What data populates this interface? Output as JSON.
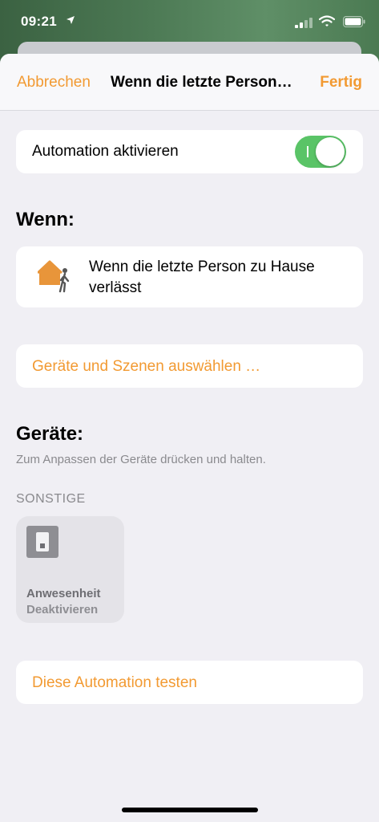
{
  "status_bar": {
    "time": "09:21"
  },
  "nav": {
    "cancel_label": "Abbrechen",
    "title": "Wenn die letzte Person…",
    "done_label": "Fertig"
  },
  "automation_toggle": {
    "label": "Automation aktivieren",
    "enabled": true
  },
  "trigger_section": {
    "title": "Wenn:",
    "trigger_text": "Wenn die letzte Person zu Hause verlässt",
    "icon": "home-leave-icon"
  },
  "select_button": {
    "label": "Geräte und Szenen auswählen …"
  },
  "devices_section": {
    "title": "Geräte:",
    "hint": "Zum Anpassen der Geräte drücken und halten.",
    "category": "SONSTIGE",
    "tiles": [
      {
        "name": "Anwesenheit",
        "state": "Deaktivieren",
        "icon": "switch-icon"
      }
    ]
  },
  "test_button": {
    "label": "Diese Automation testen"
  },
  "colors": {
    "accent": "#f29a32",
    "toggle_on": "#5ac467",
    "background": "#f0eff4"
  }
}
